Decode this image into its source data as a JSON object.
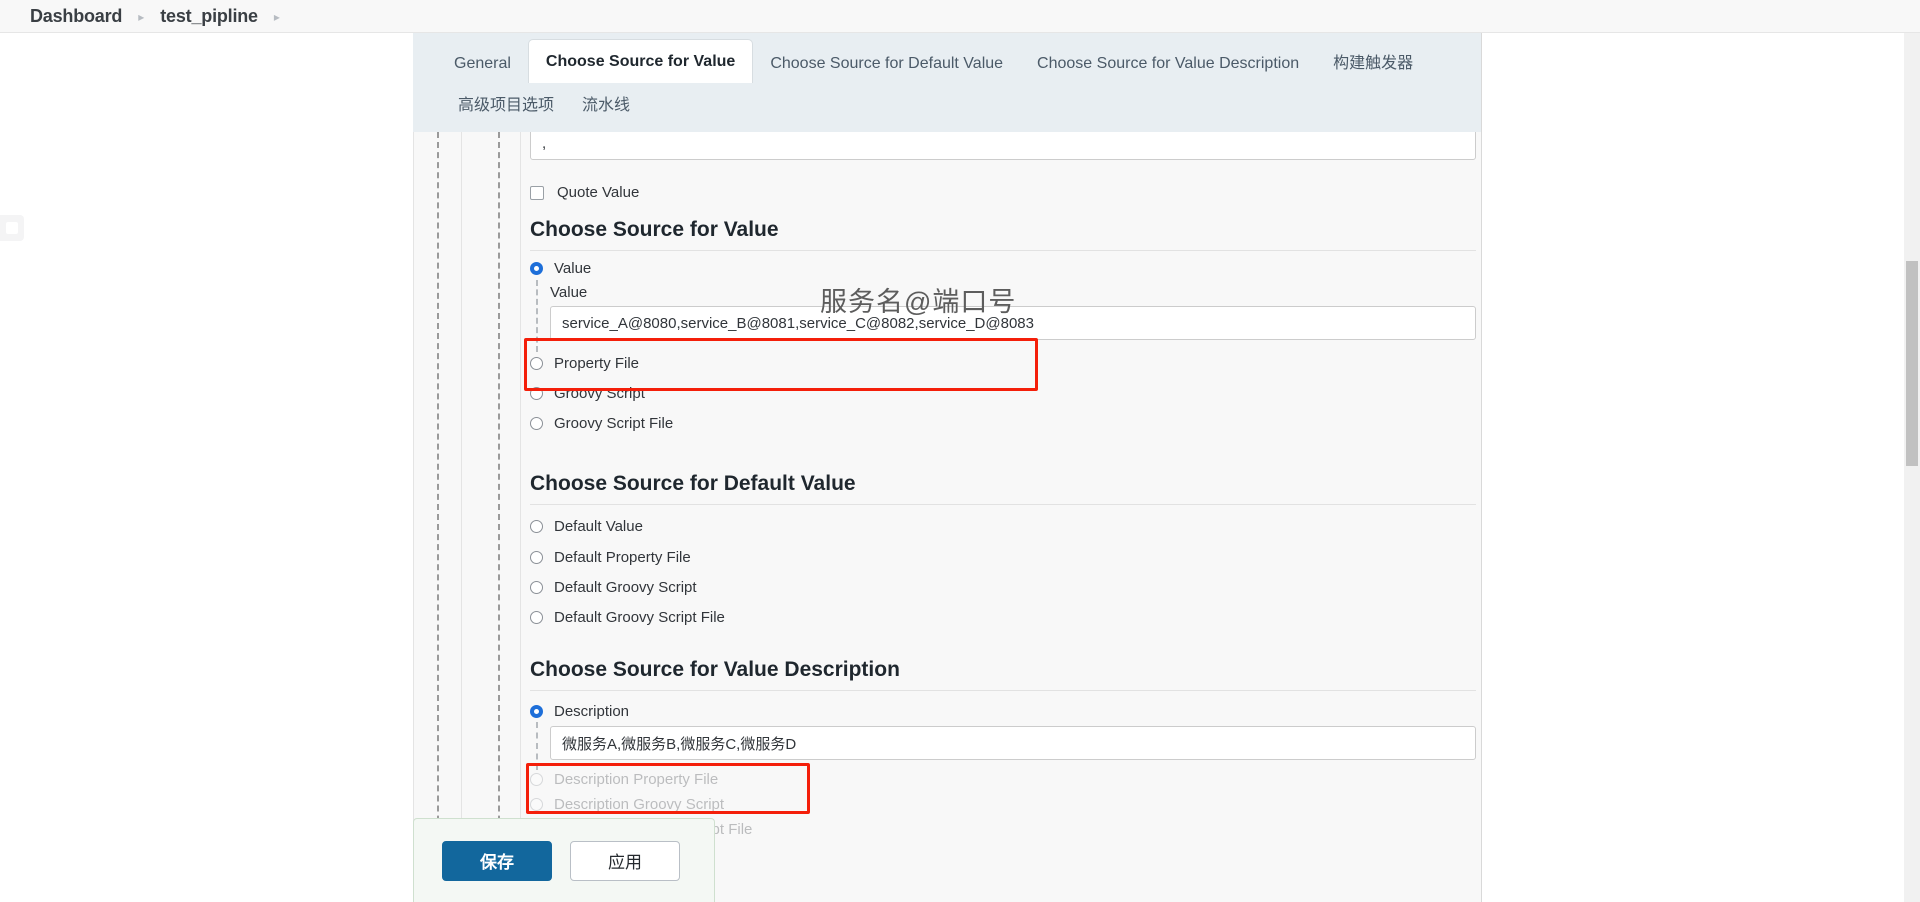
{
  "breadcrumb": {
    "items": [
      {
        "label": "Dashboard"
      },
      {
        "label": "test_pipline"
      }
    ],
    "separator": "▸"
  },
  "tabs": {
    "row1": [
      {
        "label": "General",
        "active": false
      },
      {
        "label": "Choose Source for Value",
        "active": true
      },
      {
        "label": "Choose Source for Default Value",
        "active": false
      },
      {
        "label": "Choose Source for Value Description",
        "active": false
      },
      {
        "label": "构建触发器",
        "active": false
      }
    ],
    "row2": [
      {
        "label": "高级项目选项",
        "active": false
      },
      {
        "label": "流水线",
        "active": false
      }
    ]
  },
  "form": {
    "top_input": {
      "value": ",",
      "placeholder": ""
    },
    "quote_value": {
      "label": "Quote Value",
      "checked": false
    },
    "annotation": "服务名@端口号",
    "sections": [
      {
        "title": "Choose Source for Value",
        "options": [
          {
            "label": "Value",
            "selected": true
          },
          {
            "label": "Property File",
            "selected": false
          },
          {
            "label": "Groovy Script",
            "selected": false
          },
          {
            "label": "Groovy Script File",
            "selected": false
          }
        ],
        "subfield": {
          "label": "Value",
          "value": "service_A@8080,service_B@8081,service_C@8082,service_D@8083",
          "placeholder": "",
          "highlighted": true
        }
      },
      {
        "title": "Choose Source for Default Value",
        "options": [
          {
            "label": "Default Value",
            "selected": false
          },
          {
            "label": "Default Property File",
            "selected": false
          },
          {
            "label": "Default Groovy Script",
            "selected": false
          },
          {
            "label": "Default Groovy Script File",
            "selected": false
          }
        ]
      },
      {
        "title": "Choose Source for Value Description",
        "options": [
          {
            "label": "Description",
            "selected": true
          },
          {
            "label": "Description Property File",
            "selected": false
          },
          {
            "label": "Description Groovy Script",
            "selected": false
          },
          {
            "label": "Description Groovy Script File",
            "selected": false
          }
        ],
        "subfield": {
          "label": "",
          "value": "微服务A,微服务B,微服务C,微服务D",
          "placeholder": "",
          "highlighted": true
        }
      }
    ]
  },
  "savebar": {
    "save_label": "保存",
    "apply_label": "应用"
  },
  "colors": {
    "accent_blue": "#12679d",
    "radio_blue": "#1e6fd9",
    "highlight_red": "#f41f0a",
    "tab_bg": "#e8eef2",
    "form_bg": "#f8f8f8"
  }
}
